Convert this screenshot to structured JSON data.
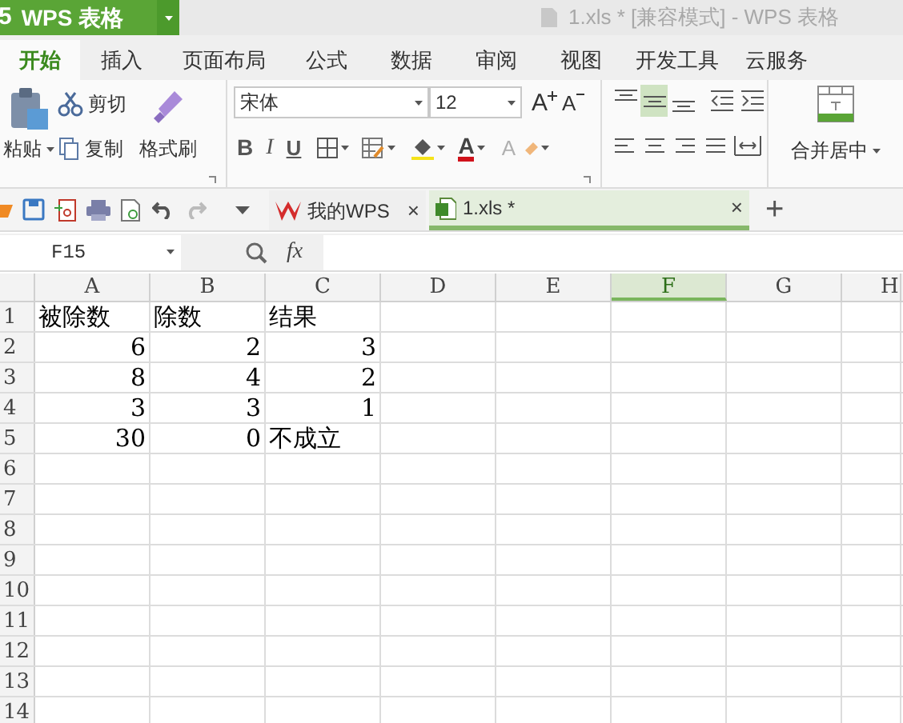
{
  "app_button": {
    "logo": "5",
    "label": "WPS 表格"
  },
  "window": {
    "title": "1.xls * [兼容模式] - WPS 表格"
  },
  "tabs": [
    {
      "label": "开始",
      "selected": true
    },
    {
      "label": "插入",
      "selected": false
    },
    {
      "label": "页面布局",
      "selected": false
    },
    {
      "label": "公式",
      "selected": false
    },
    {
      "label": "数据",
      "selected": false
    },
    {
      "label": "审阅",
      "selected": false
    },
    {
      "label": "视图",
      "selected": false
    },
    {
      "label": "开发工具",
      "selected": false
    },
    {
      "label": "云服务",
      "selected": false
    }
  ],
  "clipboard": {
    "paste": "粘贴",
    "cut": "剪切",
    "copy": "复制",
    "format_painter": "格式刷"
  },
  "font": {
    "name": "宋体",
    "size": "12",
    "grow": "A",
    "shrink": "A",
    "bold": "B",
    "italic": "I",
    "underline": "U",
    "color_letter": "A",
    "clear_letter": "A"
  },
  "align_top": [
    {
      "selected": false
    },
    {
      "selected": true
    },
    {
      "selected": false
    }
  ],
  "merge": {
    "label": "合并居中"
  },
  "doc_tabs": [
    {
      "label": "我的WPS",
      "close": "×",
      "kind": "home",
      "selected": false
    },
    {
      "label": "1.xls *",
      "close": "×",
      "kind": "sheet",
      "selected": true
    }
  ],
  "new_tab": "+",
  "formula_bar": {
    "cell": "F15",
    "fx": "fx"
  },
  "columns": [
    {
      "label": "A",
      "selected": false
    },
    {
      "label": "B",
      "selected": false
    },
    {
      "label": "C",
      "selected": false
    },
    {
      "label": "D",
      "selected": false
    },
    {
      "label": "E",
      "selected": false
    },
    {
      "label": "F",
      "selected": true
    },
    {
      "label": "G",
      "selected": false
    },
    {
      "label": "H",
      "selected": false
    }
  ],
  "rows": [
    {
      "number": "1",
      "cells": [
        {
          "kind": "text",
          "text": "被除数"
        },
        {
          "kind": "text",
          "text": "除数"
        },
        {
          "kind": "text",
          "text": "结果"
        }
      ]
    },
    {
      "number": "2",
      "cells": [
        {
          "kind": "number",
          "text": "6"
        },
        {
          "kind": "number",
          "text": "2"
        },
        {
          "kind": "number",
          "text": "3"
        }
      ]
    },
    {
      "number": "3",
      "cells": [
        {
          "kind": "number",
          "text": "8"
        },
        {
          "kind": "number",
          "text": "4"
        },
        {
          "kind": "number",
          "text": "2"
        }
      ]
    },
    {
      "number": "4",
      "cells": [
        {
          "kind": "number",
          "text": "3"
        },
        {
          "kind": "number",
          "text": "3"
        },
        {
          "kind": "number",
          "text": "1"
        }
      ]
    },
    {
      "number": "5",
      "cells": [
        {
          "kind": "number",
          "text": "30"
        },
        {
          "kind": "number",
          "text": "0"
        },
        {
          "kind": "text",
          "text": "不成立"
        }
      ]
    },
    {
      "number": "6",
      "cells": []
    },
    {
      "number": "7",
      "cells": []
    },
    {
      "number": "8",
      "cells": []
    },
    {
      "number": "9",
      "cells": []
    },
    {
      "number": "10",
      "cells": []
    },
    {
      "number": "11",
      "cells": []
    },
    {
      "number": "12",
      "cells": []
    },
    {
      "number": "13",
      "cells": []
    },
    {
      "number": "14",
      "cells": []
    }
  ]
}
